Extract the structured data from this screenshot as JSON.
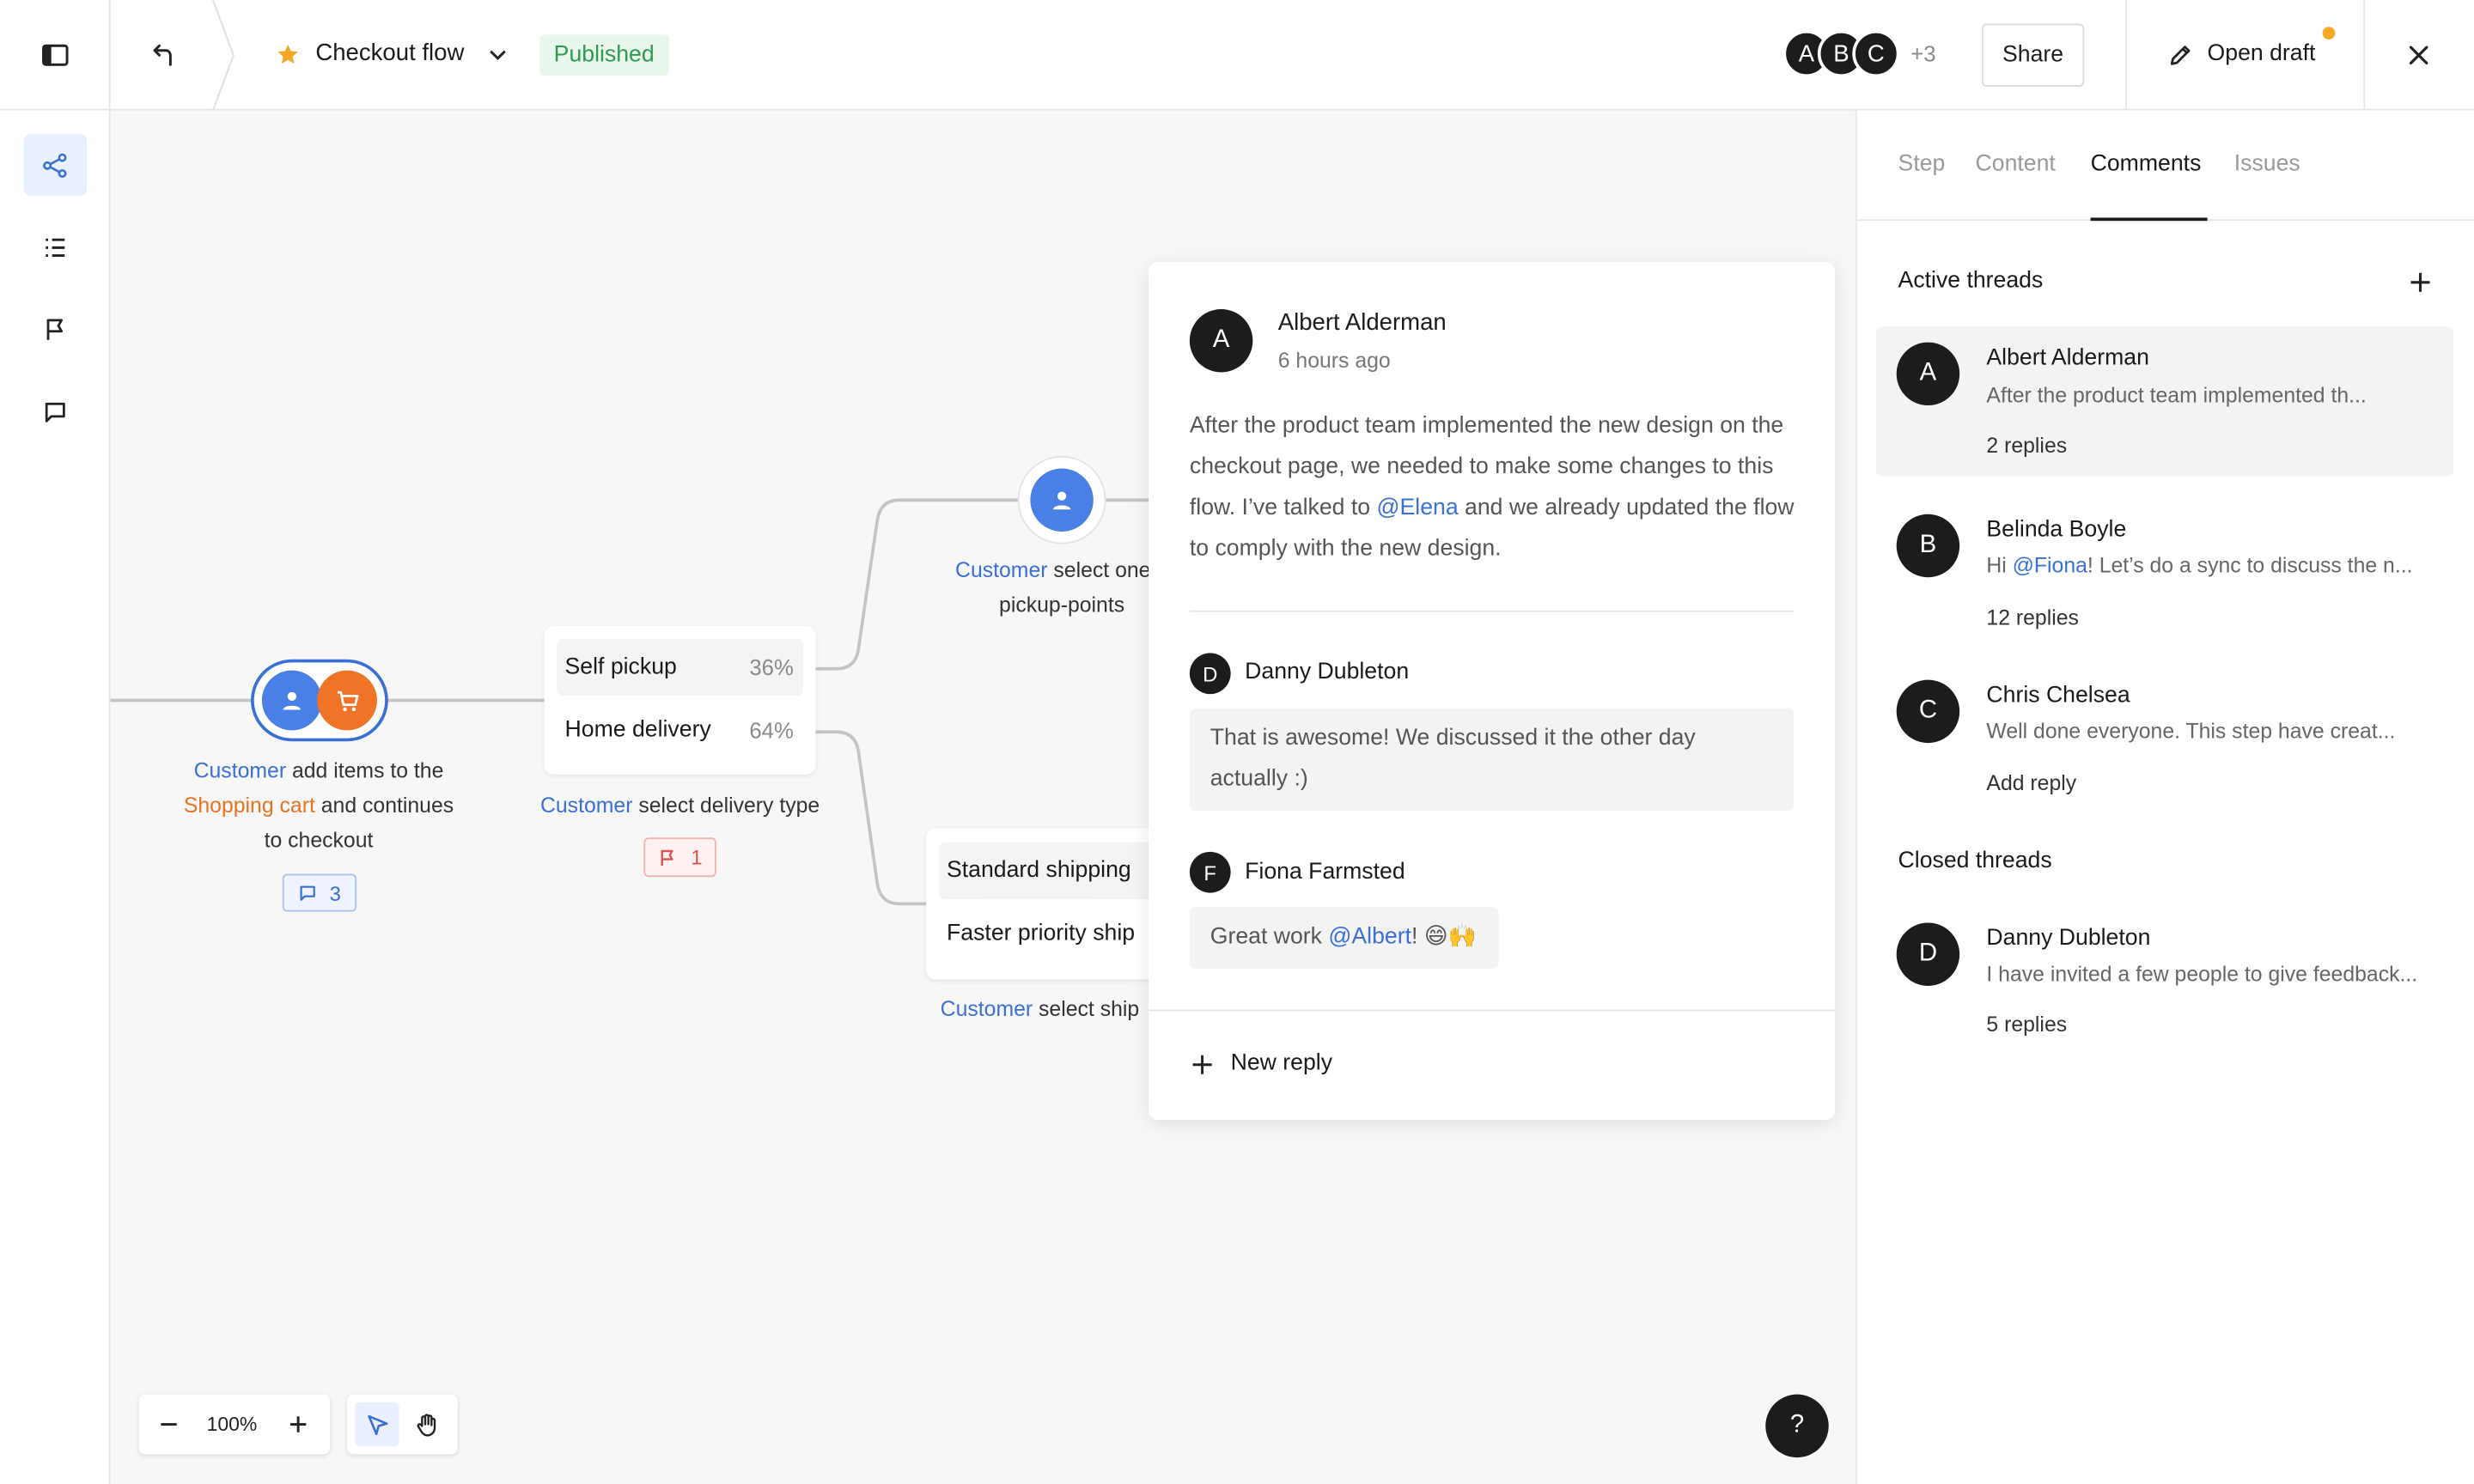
{
  "header": {
    "flow_title": "Checkout flow",
    "status": "Published",
    "collaborators": [
      "A",
      "B",
      "C"
    ],
    "collaborators_more": "+3",
    "share_label": "Share",
    "open_draft_label": "Open draft"
  },
  "canvas": {
    "node1": {
      "actor": "Customer",
      "text_a": " add items to the",
      "entity": "Shopping cart",
      "text_b": " and continues",
      "text_c": "to checkout",
      "comment_count": "3"
    },
    "node2": {
      "options": [
        {
          "label": "Self pickup",
          "pct": "36%"
        },
        {
          "label": "Home delivery",
          "pct": "64%"
        }
      ],
      "actor": "Customer",
      "text": " select delivery type",
      "flag_count": "1"
    },
    "node3": {
      "actor": "Customer",
      "text_a": " select one o",
      "text_b": "pickup-points"
    },
    "node4": {
      "options": [
        {
          "label": "Standard shipping"
        },
        {
          "label": "Faster priority ship"
        }
      ],
      "actor": "Customer",
      "text": " select ship"
    },
    "zoom": "100%"
  },
  "popover": {
    "author": {
      "initial": "A",
      "name": "Albert Alderman",
      "time": "6 hours ago"
    },
    "body_a": "After the product team implemented the new design on the checkout page, we needed to make some changes to this flow. I’ve talked to ",
    "mention_a": "@Elena",
    "body_b": " and we already updated the flow to comply with the new design.",
    "replies": [
      {
        "initial": "D",
        "name": "Danny Dubleton",
        "text": "That is awesome! We discussed it the other day actually :)"
      },
      {
        "initial": "F",
        "name": "Fiona Farmsted",
        "text_a": "Great work ",
        "mention": "@Albert",
        "text_b": "! 😄🙌"
      }
    ],
    "new_reply_label": "New reply"
  },
  "panel": {
    "tabs": [
      "Step",
      "Content",
      "Comments",
      "Issues"
    ],
    "active_tab": "Comments",
    "active_heading": "Active threads",
    "closed_heading": "Closed threads",
    "active_threads": [
      {
        "initial": "A",
        "name": "Albert Alderman",
        "preview": "After the product team implemented th...",
        "meta": "2 replies"
      },
      {
        "initial": "B",
        "name": "Belinda Boyle",
        "preview_pre": "Hi ",
        "preview_mention": "@Fiona",
        "preview_post": "! Let’s do a sync to discuss the n...",
        "meta": "12 replies"
      },
      {
        "initial": "C",
        "name": "Chris Chelsea",
        "preview": "Well done everyone. This step have creat...",
        "meta": "Add reply"
      }
    ],
    "closed_threads": [
      {
        "initial": "D",
        "name": "Danny Dubleton",
        "preview": "I have invited a few people to give feedback...",
        "meta": "5 replies"
      }
    ]
  },
  "colors": {
    "accent": "#3a6fd8",
    "orange": "#f07427",
    "published": "#2f9a52",
    "notify_dot": "#f5a623",
    "flag": "#d9534f"
  },
  "help_label": "?"
}
